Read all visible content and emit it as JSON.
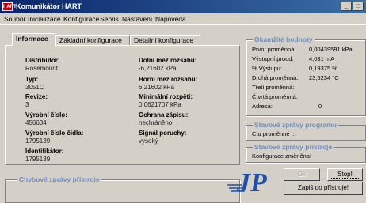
{
  "window": {
    "title": "Komunikátor HART",
    "icon_text": "HART"
  },
  "menu": [
    "Soubor",
    "Inicializace",
    "Konfigurace",
    "Servis",
    "Nastavení",
    "Nápověda"
  ],
  "tabs": [
    {
      "label": "Informace",
      "active": true
    },
    {
      "label": "Základní konfigurace",
      "active": false
    },
    {
      "label": "Detailní konfigurace",
      "active": false
    }
  ],
  "info": {
    "left": [
      {
        "label": "Distributor:",
        "value": "Rosemount"
      },
      {
        "label": "Typ:",
        "value": "3051C"
      },
      {
        "label": "Revize:",
        "value": "3"
      },
      {
        "label": "Výrobní číslo:",
        "value": "456634"
      },
      {
        "label": "Výrobní číslo čidla:",
        "value": "1795139"
      },
      {
        "label": "Identifikátor:",
        "value": "1795139"
      }
    ],
    "right": [
      {
        "label": "Dolní mez rozsahu:",
        "value": "-6,21602 kPa"
      },
      {
        "label": "Horní mez rozsahu:",
        "value": "6,21602 kPa"
      },
      {
        "label": "Minimální rozpětí:",
        "value": "0,0621707 kPa"
      },
      {
        "label": "Ochrana zápisu:",
        "value": "nechráněno"
      },
      {
        "label": "Signál poruchy:",
        "value": "vysoký"
      }
    ]
  },
  "device_messages": {
    "title": "Chybové zprávy přístroje"
  },
  "instant_values": {
    "title": "Okamžité hodnoty",
    "rows": [
      {
        "label": "První proměnná:",
        "value": "0,00439591 kPa"
      },
      {
        "label": "Výstupní proud:",
        "value": "4,031 mA"
      },
      {
        "label": "% Výstupu:",
        "value": "0,19375 %"
      },
      {
        "label": "Druhá proměnná:",
        "value": "23,5234 °C"
      },
      {
        "label": "Třetí proměnná:",
        "value": ""
      },
      {
        "label": "Čtvrtá proměnná:",
        "value": ""
      },
      {
        "label": "Adresa:",
        "value": "0"
      }
    ]
  },
  "program_status": {
    "title": "Stavové zprávy programu",
    "text": "Ctu proměnné ..."
  },
  "device_status": {
    "title": "Stavové zprávy přístroje",
    "text": "Konfigurace změněna!"
  },
  "buttons": {
    "start": "Ok",
    "stop": "Stop!",
    "write": "Zapiš do přístroje!"
  },
  "logo": {
    "text": "JP",
    "color": "#1f4fa8"
  }
}
